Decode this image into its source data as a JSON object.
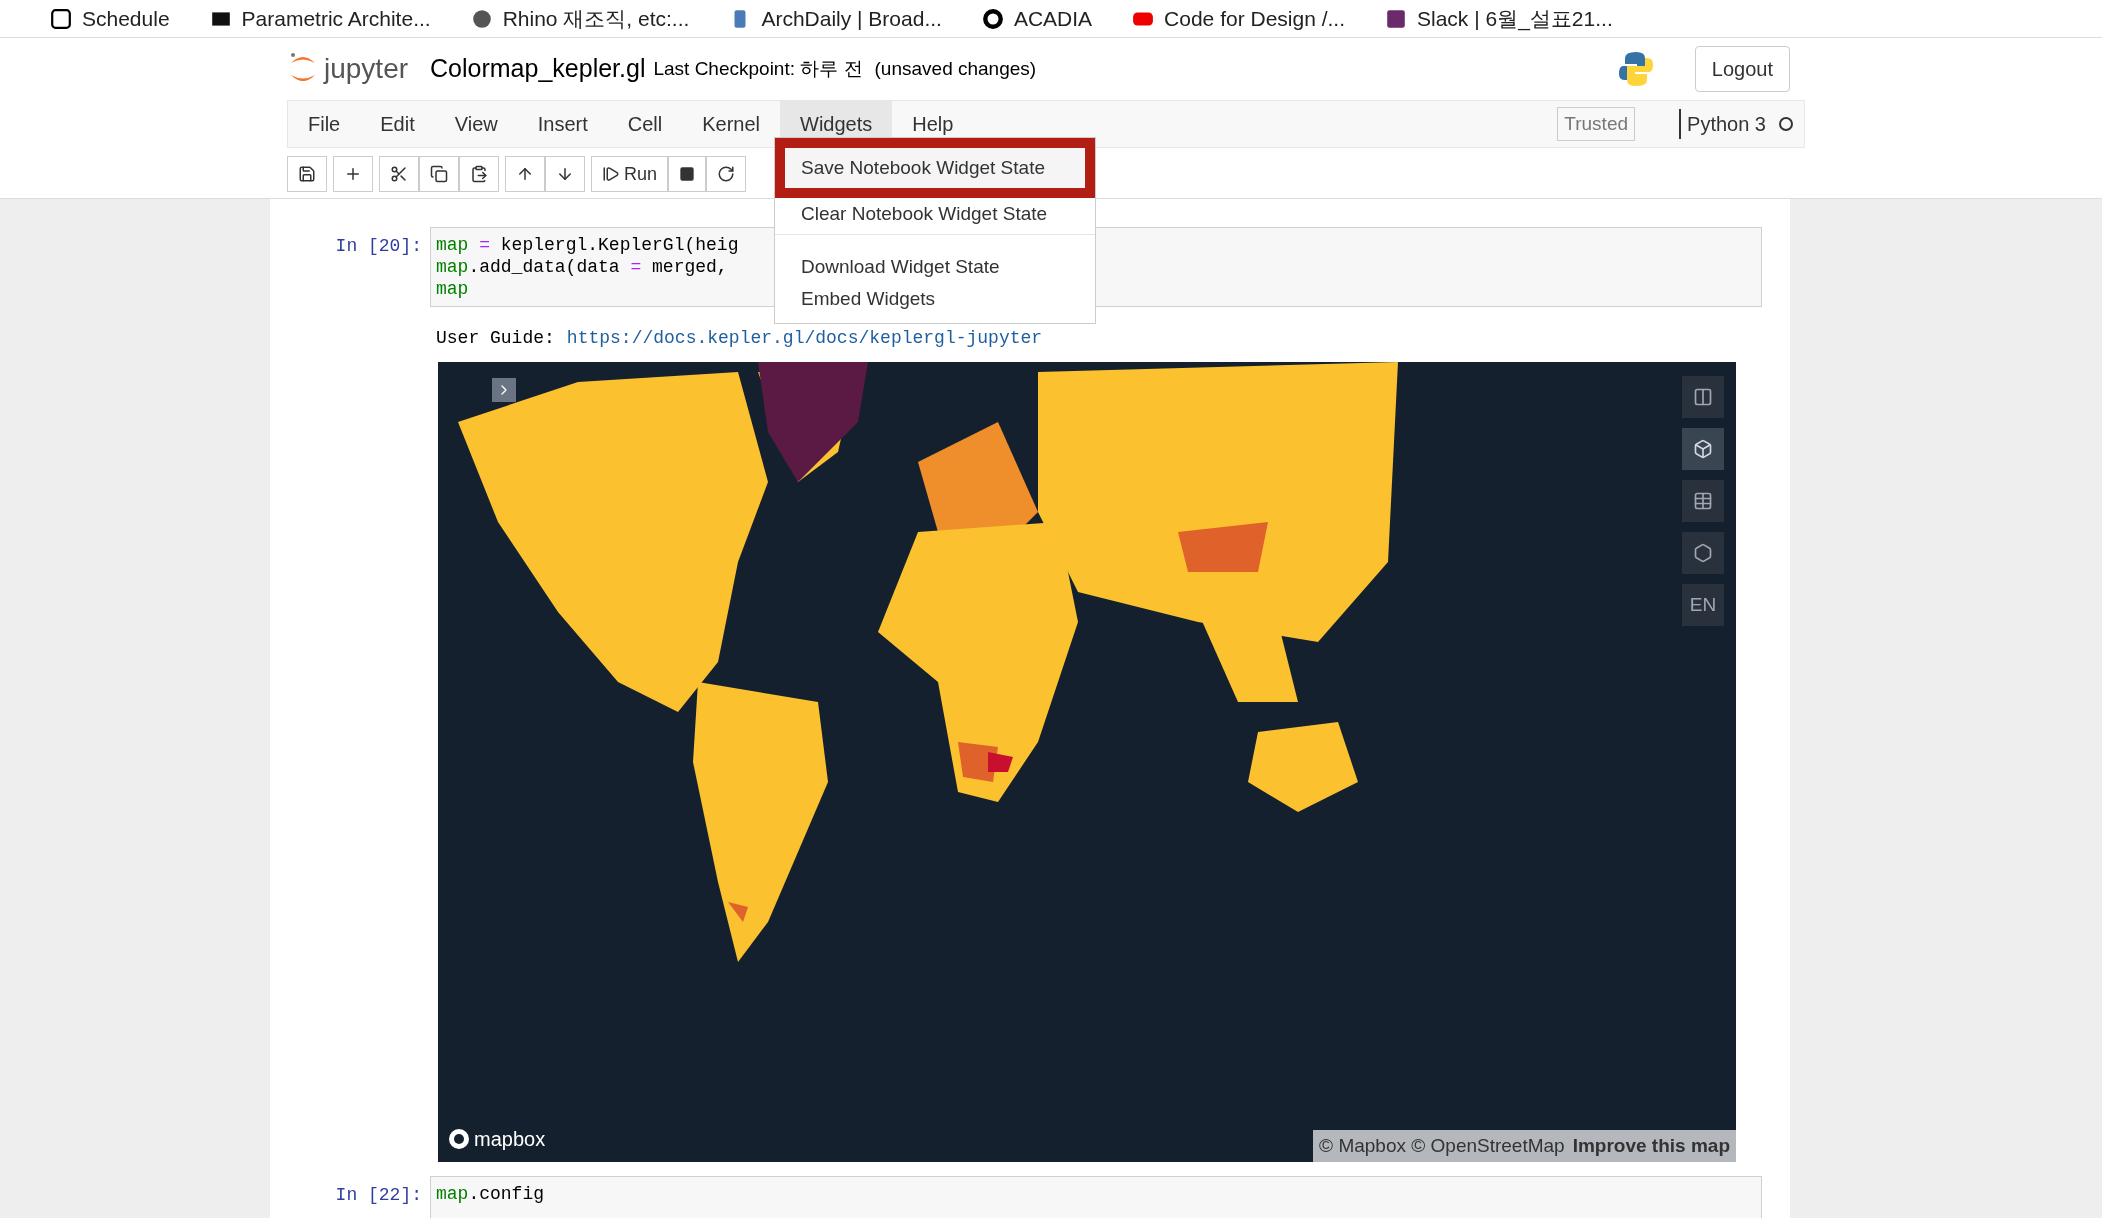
{
  "bookmarks": [
    {
      "label": "Schedule"
    },
    {
      "label": "Parametric Archite..."
    },
    {
      "label": "Rhino 재조직, etc:..."
    },
    {
      "label": "ArchDaily | Broad..."
    },
    {
      "label": "ACADIA"
    },
    {
      "label": "Code for Design /..."
    },
    {
      "label": "Slack | 6월_설표21..."
    }
  ],
  "header": {
    "logo": "jupyter",
    "notebook_title": "Colormap_kepler.gl",
    "checkpoint": "Last Checkpoint: 하루 전",
    "save_status": "(unsaved changes)",
    "logout": "Logout"
  },
  "menu": [
    {
      "label": "File",
      "selected": false
    },
    {
      "label": "Edit",
      "selected": false
    },
    {
      "label": "View",
      "selected": false
    },
    {
      "label": "Insert",
      "selected": false
    },
    {
      "label": "Cell",
      "selected": false
    },
    {
      "label": "Kernel",
      "selected": false
    },
    {
      "label": "Widgets",
      "selected": true
    },
    {
      "label": "Help",
      "selected": false
    }
  ],
  "kernel": {
    "trusted": "Trusted",
    "name": "Python 3"
  },
  "toolbar": {
    "run": "Run"
  },
  "widgets_menu": {
    "groups": [
      [
        {
          "label": "Save Notebook Widget State",
          "highlighted": true
        },
        {
          "label": "Clear Notebook Widget State",
          "highlighted": false
        }
      ],
      [
        {
          "label": "Download Widget State",
          "highlighted": false
        },
        {
          "label": "Embed Widgets",
          "highlighted": false
        }
      ]
    ]
  },
  "cells": [
    {
      "prompt": "In [20]:",
      "lines": [
        [
          {
            "kind": "builtin",
            "text": "map"
          },
          {
            "kind": "operator",
            "text": " ="
          },
          {
            "kind": "plain",
            "text": " keplergl.KeplerGl(heig"
          }
        ],
        [
          {
            "kind": "builtin",
            "text": "map"
          },
          {
            "kind": "plain",
            "text": ".add_data(data "
          },
          {
            "kind": "operator",
            "text": "="
          },
          {
            "kind": "plain",
            "text": " merged,"
          }
        ],
        [
          {
            "kind": "builtin",
            "text": "map"
          }
        ]
      ],
      "output": {
        "label": "User Guide:",
        "link": "https://docs.kepler.gl/docs/keplergl-jupyter"
      },
      "map": {
        "language": "EN",
        "logo": "mapbox",
        "attribution": "© Mapbox © OpenStreetMap",
        "improve_link": "Improve this map"
      }
    },
    {
      "prompt": "In [22]:",
      "lines": [
        [
          {
            "kind": "builtin",
            "text": "map"
          },
          {
            "kind": "plain",
            "text": ".config"
          }
        ]
      ]
    }
  ]
}
